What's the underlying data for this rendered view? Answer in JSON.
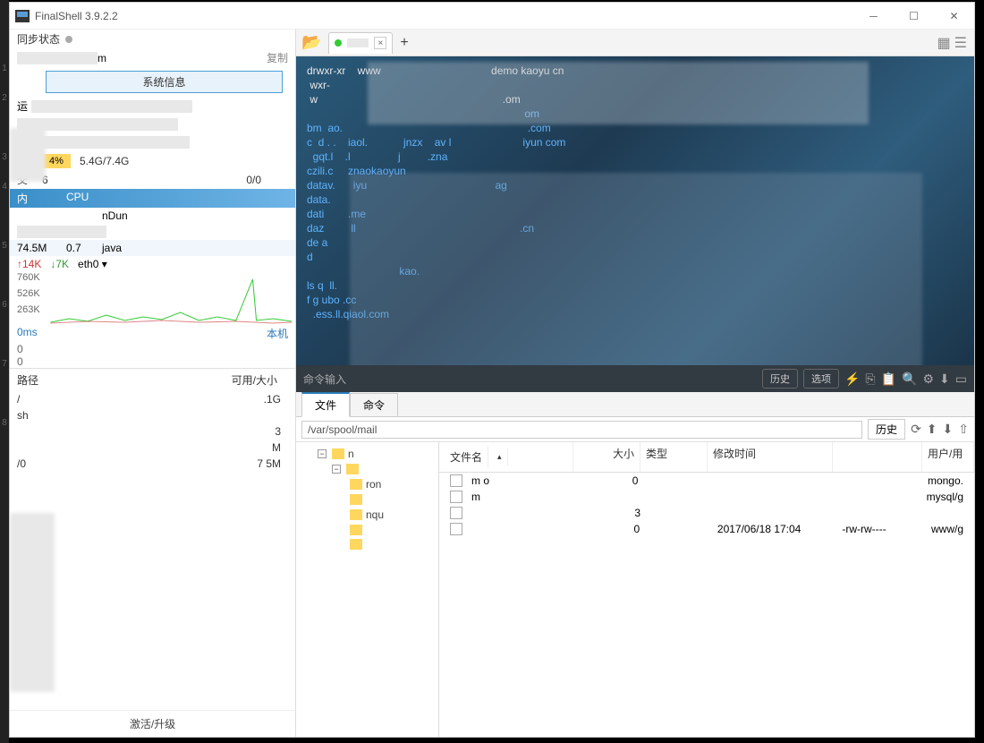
{
  "titlebar": {
    "title": "FinalShell 3.9.2.2"
  },
  "sidebar": {
    "sync_label": "同步状态",
    "copy_label": "复制",
    "host_suffix": "m",
    "sysinfo_btn": "系统信息",
    "mem": {
      "label": "内",
      "pct": "4%",
      "text": "5.4G/7.4G"
    },
    "swap": {
      "label": "交",
      "val": "6",
      "text": "0/0"
    },
    "proc_header": {
      "col1": "内",
      "col2": "CPU"
    },
    "procs": [
      {
        "mem": "",
        "cpu": "",
        "name": "nDun"
      },
      {
        "mem": "74.5M",
        "cpu": "0.7",
        "name": "java"
      }
    ],
    "net": {
      "up": "14K",
      "down": "7K",
      "iface": "eth0"
    },
    "graph": {
      "y1": "760K",
      "y2": "526K",
      "y3": "263K"
    },
    "latency": {
      "ms": "0ms",
      "local": "本机",
      "v1": "0",
      "v2": "0"
    },
    "disk_hdr": {
      "path": "路径",
      "avail": "可用/大小"
    },
    "disks": [
      {
        "path": "/",
        "avail": ".1G"
      },
      {
        "path": "sh",
        "avail": ""
      },
      {
        "path": "",
        "avail": "3"
      },
      {
        "path": "",
        "avail": "M"
      },
      {
        "path": "/0",
        "avail": "7          5M"
      }
    ],
    "activate": "激活/升级"
  },
  "tabbar": {
    "tab_close": "×",
    "add": "+"
  },
  "terminal": {
    "lines": [
      "drwxr-xr    www                                     demo kaoyu cn",
      "",
      " wxr-",
      " w                                                              .om",
      "",
      "",
      "                                                                         om",
      "bm  ao.                                                              .com",
      "c  d . .    iaol.            jnzx    av l                        iyun com",
      "  gqt.l    .l                j         .zna",
      "czili.c     znaokaoyun",
      "datav.      iyu                                           ag",
      "data.",
      "dati        .me",
      "daz         ll                                                       .cn",
      "de a",
      "d",
      "                               kao.",
      "ls q  ll.",
      "f g ubo .cc",
      "",
      "  .ess.ll.qiaol.com"
    ]
  },
  "cmdbar": {
    "placeholder": "命令输入",
    "history": "历史",
    "options": "选项"
  },
  "bottom_tabs": {
    "files": "文件",
    "cmds": "命令"
  },
  "pathbar": {
    "path": "/var/spool/mail",
    "history": "历史"
  },
  "tree": {
    "n0": "n",
    "n1": "ron",
    "n2": "nqu"
  },
  "filelist": {
    "hdr": {
      "name": "文件名",
      "size": "大小",
      "type": "类型",
      "date": "修改时间",
      "perm": "",
      "owner": "用户/用"
    },
    "rows": [
      {
        "name": "m      o",
        "size": "0",
        "type": "",
        "date": "",
        "perm": "",
        "owner": "mongo."
      },
      {
        "name": "m",
        "size": "",
        "type": "",
        "date": "",
        "perm": "",
        "owner": "mysql/g"
      },
      {
        "name": "",
        "size": "3",
        "type": "",
        "date": "",
        "perm": "",
        "owner": ""
      },
      {
        "name": "",
        "size": "0",
        "type": "",
        "date": "2017/06/18 17:04",
        "perm": "-rw-rw----",
        "owner": "www/g"
      }
    ]
  }
}
